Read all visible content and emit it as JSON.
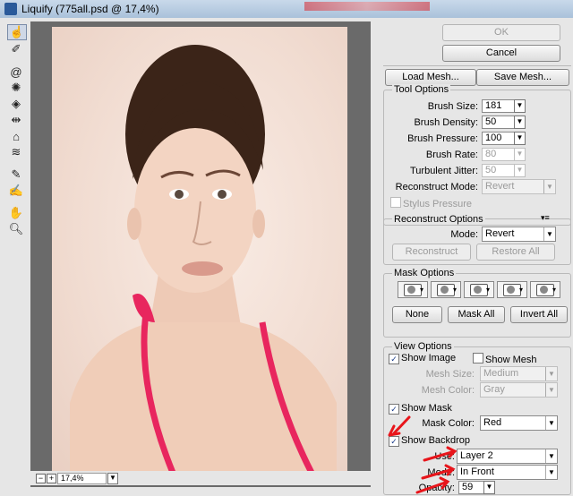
{
  "window": {
    "title": "Liquify (775all.psd @ 17,4%)"
  },
  "tools": [
    "forward-warp-icon",
    "reconstruct-icon",
    "twirl-icon",
    "pucker-icon",
    "bloat-icon",
    "push-left-icon",
    "mirror-icon",
    "turbulence-icon",
    "freeze-mask-icon",
    "thaw-mask-icon",
    "hand-icon",
    "zoom-icon"
  ],
  "status": {
    "zoom_out": "−",
    "zoom_in": "+",
    "zoom": "17,4%"
  },
  "buttons": {
    "ok": "OK",
    "cancel": "Cancel",
    "load_mesh": "Load Mesh...",
    "save_mesh": "Save Mesh..."
  },
  "tool_options": {
    "title": "Tool Options",
    "brush_size_label": "Brush Size:",
    "brush_size": "181",
    "brush_density_label": "Brush Density:",
    "brush_density": "50",
    "brush_pressure_label": "Brush Pressure:",
    "brush_pressure": "100",
    "brush_rate_label": "Brush Rate:",
    "brush_rate": "80",
    "turbulent_jitter_label": "Turbulent Jitter:",
    "turbulent_jitter": "50",
    "reconstruct_mode_label": "Reconstruct Mode:",
    "reconstruct_mode": "Revert",
    "stylus_pressure": "Stylus Pressure"
  },
  "reconstruct_options": {
    "title": "Reconstruct Options",
    "mode_label": "Mode:",
    "mode": "Revert",
    "reconstruct": "Reconstruct",
    "restore_all": "Restore All"
  },
  "mask_options": {
    "title": "Mask Options",
    "none": "None",
    "mask_all": "Mask All",
    "invert_all": "Invert All"
  },
  "view_options": {
    "title": "View Options",
    "show_image": "Show Image",
    "show_mesh": "Show Mesh",
    "mesh_size_label": "Mesh Size:",
    "mesh_size": "Medium",
    "mesh_color_label": "Mesh Color:",
    "mesh_color": "Gray",
    "show_mask": "Show Mask",
    "mask_color_label": "Mask Color:",
    "mask_color": "Red",
    "show_backdrop": "Show Backdrop",
    "use_label": "Use:",
    "use": "Layer 2",
    "mode_label": "Mode:",
    "mode": "In Front",
    "opacity_label": "Opacity:",
    "opacity": "59"
  },
  "colors": {
    "accent_arrow": "#e8151b",
    "swimsuit": "#e8265e"
  }
}
